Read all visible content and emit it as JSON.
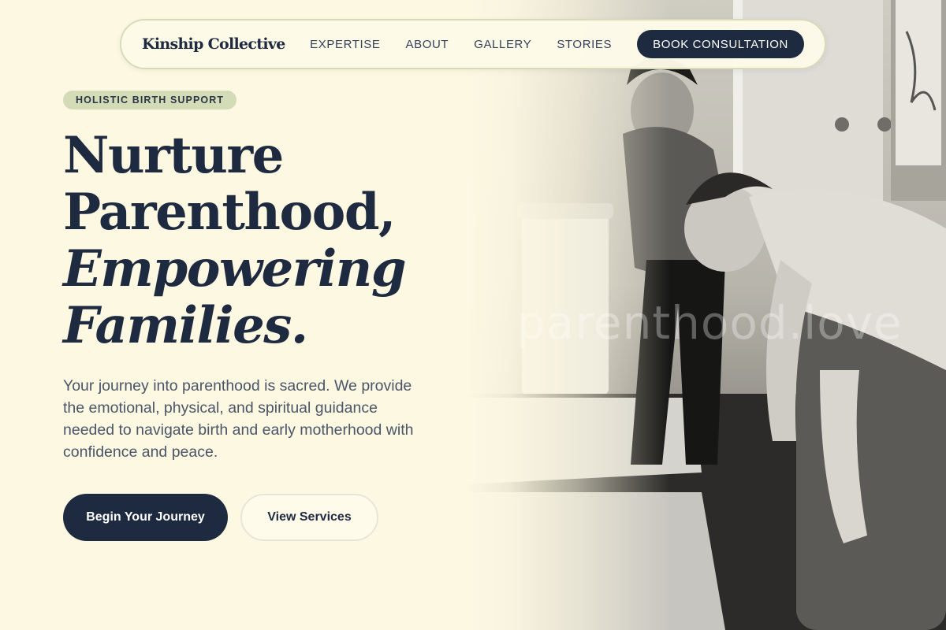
{
  "brand": {
    "name": "Kinship Collective"
  },
  "nav": {
    "links": [
      "EXPERTISE",
      "ABOUT",
      "GALLERY",
      "STORIES"
    ],
    "cta": "BOOK CONSULTATION"
  },
  "hero": {
    "badge": "HOLISTIC BIRTH SUPPORT",
    "headline": {
      "line1": "Nurture",
      "line2": "Parenthood,",
      "line3": "Empowering",
      "line4": "Families."
    },
    "lead": "Your journey into parenthood is sacred. We provide the emotional, physical, and spiritual guidance needed to navigate birth and early motherhood with confidence and peace.",
    "primary_cta": "Begin Your Journey",
    "secondary_cta": "View Services",
    "photo_watermark": "parenthood.love"
  },
  "colors": {
    "background": "#fdf8e2",
    "navy": "#1e2a3f",
    "badge_green": "#d4dcb7",
    "body_text": "#4a5568"
  }
}
